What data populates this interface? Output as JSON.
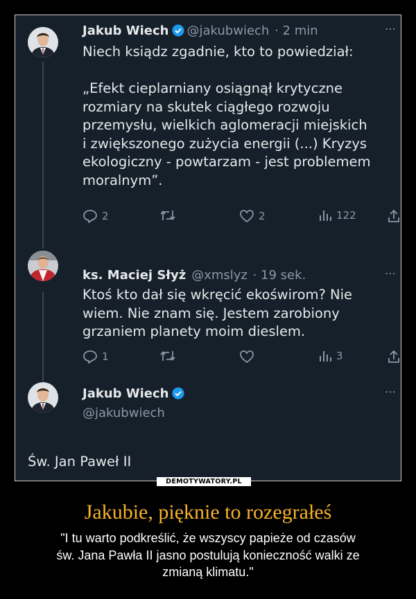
{
  "tweets": [
    {
      "name": "Jakub Wiech",
      "handle": "@jakubwiech",
      "time": "· 2 min",
      "lines": [
        "Niech ksiądz zgadnie, kto to powiedział:",
        "",
        "„Efekt cieplarniany osiągnął krytyczne",
        "rozmiary na skutek ciągłego rozwoju",
        "przemysłu, wielkich aglomeracji miejskich",
        "i zwiększonego zużycia energii (...) Kryzys",
        "ekologiczny - powtarzam - jest problemem",
        "moralnym”."
      ],
      "replies": "2",
      "retweets": "",
      "likes": "2",
      "views": "122"
    },
    {
      "name": "ks. Maciej Słyż",
      "handle": "@xmslyz",
      "time": "· 19 sek.",
      "lines": [
        "Ktoś kto dał się wkręcić ekoświrom? Nie",
        "wiem. Nie znam się. Jestem zarobiony",
        "grzaniem planety moim dieslem."
      ],
      "replies": "1",
      "retweets": "",
      "likes": "",
      "views": "3"
    },
    {
      "name": "Jakub Wiech",
      "handle": "@jakubwiech",
      "text": "Św. Jan Paweł II"
    }
  ],
  "more_icon": "⋯",
  "watermark": "DEMOTYWATORY.PL",
  "title": "Jakubie, pięknie to rozegrałeś",
  "subtitle_lines": [
    "\"I tu warto podkreślić, że wszyscy papieże od czasów",
    "św. Jana Pawła II jasno postulują konieczność walki ze",
    "zmianą klimatu.\""
  ],
  "colors": {
    "background": "#15202b",
    "text": "#e7e9ea",
    "muted": "#8b98a5",
    "verified": "#1d9bf0",
    "title": "#f7b32b"
  }
}
